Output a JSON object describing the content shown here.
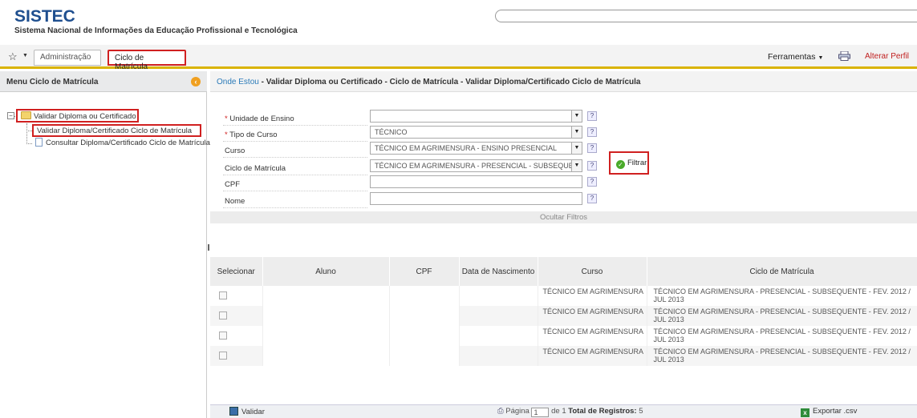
{
  "header": {
    "logo": "SISTEC",
    "subtitle": "Sistema Nacional de Informações da Educação Profissional e Tecnológica"
  },
  "menubar": {
    "tabs": [
      "Administração",
      "Ciclo de Matrícula"
    ],
    "ferramentas": "Ferramentas",
    "alterar_perfil": "Alterar Perfil"
  },
  "sidebar": {
    "title": "Menu Ciclo de Matrícula",
    "root": "Validar Diploma ou Certificado",
    "children": [
      "Validar Diploma/Certificado Ciclo de Matrícula",
      "Consultar Diploma/Certificado Ciclo de Matrícula"
    ]
  },
  "breadcrumb": {
    "where": "Onde Estou",
    "path": " - Validar Diploma ou Certificado - Ciclo de Matrícula - Validar Diploma/Certificado Ciclo de Matrícula"
  },
  "filters": {
    "unidade": {
      "label": "Unidade de Ensino",
      "value": ""
    },
    "tipo": {
      "label": "Tipo de Curso",
      "value": "TÉCNICO"
    },
    "curso": {
      "label": "Curso",
      "value": "TÉCNICO EM AGRIMENSURA - ENSINO PRESENCIAL"
    },
    "ciclo": {
      "label": "Ciclo de Matrícula",
      "value": "TÉCNICO EM AGRIMENSURA - PRESENCIAL - SUBSEQUENTE"
    },
    "cpf": {
      "label": "CPF",
      "value": ""
    },
    "nome": {
      "label": "Nome",
      "value": ""
    },
    "help": "?",
    "required_mark": "*",
    "filtrar": "Filtrar",
    "ocultar": "Ocultar Filtros"
  },
  "table": {
    "columns": [
      "Selecionar",
      "Aluno",
      "CPF",
      "Data de Nascimento",
      "Curso",
      "Ciclo de Matrícula"
    ],
    "rows": [
      {
        "curso": "TÉCNICO EM AGRIMENSURA",
        "ciclo": "TÉCNICO EM AGRIMENSURA - PRESENCIAL - SUBSEQUENTE - FEV. 2012 / JUL 2013"
      },
      {
        "curso": "TÉCNICO EM AGRIMENSURA",
        "ciclo": "TÉCNICO EM AGRIMENSURA - PRESENCIAL - SUBSEQUENTE - FEV. 2012 / JUL 2013"
      },
      {
        "curso": "TÉCNICO EM AGRIMENSURA",
        "ciclo": "TÉCNICO EM AGRIMENSURA - PRESENCIAL - SUBSEQUENTE - FEV. 2012 / JUL 2013"
      },
      {
        "curso": "TÉCNICO EM AGRIMENSURA",
        "ciclo": "TÉCNICO EM AGRIMENSURA - PRESENCIAL - SUBSEQUENTE - FEV. 2012 / JUL 2013"
      }
    ]
  },
  "footer": {
    "validar": "Validar",
    "pagina_label": "Página",
    "page": "1",
    "de": "de 1",
    "total_label": "Total de Registros:",
    "total": "5",
    "exportar": "Exportar .csv"
  },
  "colors": {
    "accent_red": "#d02020",
    "logo_blue": "#1f4f8f",
    "link_blue": "#2a7ab8",
    "menubar_border": "#d9b300"
  },
  "icons": [
    "star-icon",
    "printer-icon",
    "collapse-icon",
    "folder-icon",
    "document-icon",
    "help-icon",
    "check-icon",
    "save-icon",
    "excel-icon"
  ]
}
